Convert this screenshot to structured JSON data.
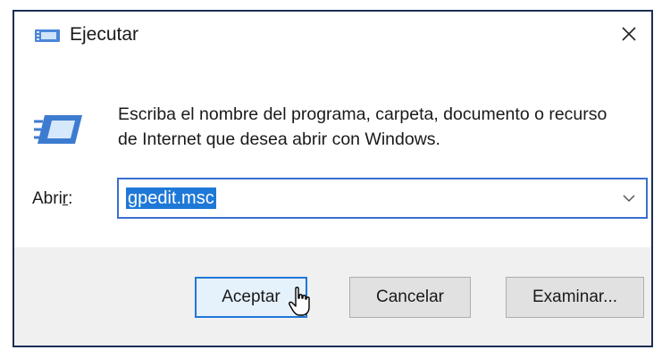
{
  "window": {
    "title": "Ejecutar",
    "title_icon": "run-icon",
    "close_icon": "close-icon"
  },
  "body": {
    "icon": "run-icon",
    "description": "Escriba el nombre del programa, carpeta, documento o recurso de Internet que desea abrir con Windows."
  },
  "open_field": {
    "label_prefix": "Abri",
    "label_access_key": "r",
    "label_suffix": ":",
    "value": "gpedit.msc",
    "dropdown_icon": "chevron-down-icon"
  },
  "buttons": {
    "ok_label": "Aceptar",
    "cancel_label": "Cancelar",
    "browse_label": "Examinar..."
  },
  "colors": {
    "accent": "#1e78d7",
    "frame": "#1a2f55"
  }
}
